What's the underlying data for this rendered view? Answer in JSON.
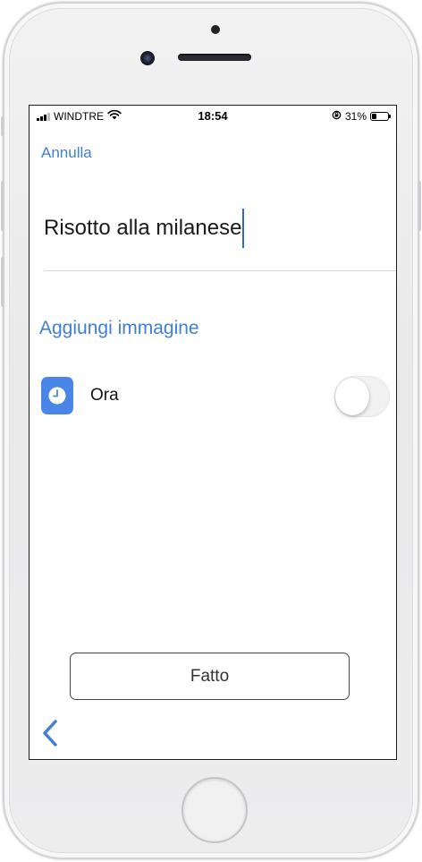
{
  "status_bar": {
    "carrier": "WINDTRE",
    "time": "18:54",
    "battery_percent_label": "31%",
    "battery_level": 0.31
  },
  "header": {
    "cancel_label": "Annulla"
  },
  "form": {
    "title_value": "Risotto alla milanese",
    "add_image_label": "Aggiungi immagine",
    "time_row_label": "Ora",
    "time_toggle_on": false
  },
  "footer": {
    "done_label": "Fatto"
  },
  "icons": {
    "time_row": "clock-icon",
    "back": "chevron-left-icon"
  },
  "colors": {
    "accent": "#3f7fd6",
    "clock_icon_bg": "#4a86e8",
    "caret": "#2f66d8"
  }
}
